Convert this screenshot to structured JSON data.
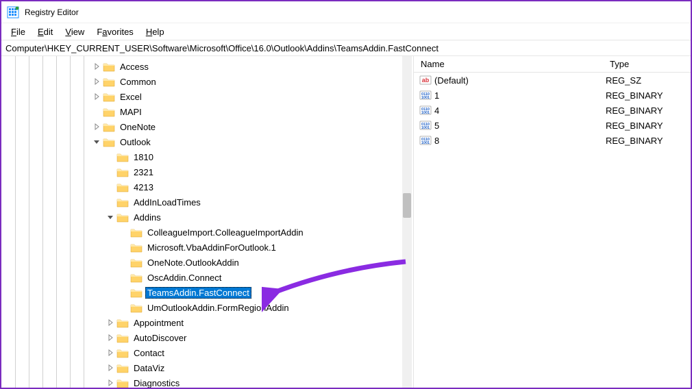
{
  "window": {
    "title": "Registry Editor"
  },
  "menu": {
    "file": "File",
    "edit": "Edit",
    "view": "View",
    "favorites": "Favorites",
    "help": "Help"
  },
  "addressbar": {
    "path": "Computer\\HKEY_CURRENT_USER\\Software\\Microsoft\\Office\\16.0\\Outlook\\Addins\\TeamsAddin.FastConnect"
  },
  "tree": {
    "items": [
      {
        "label": "Access",
        "indent": 7,
        "twisty": "right",
        "selected": false
      },
      {
        "label": "Common",
        "indent": 7,
        "twisty": "right",
        "selected": false
      },
      {
        "label": "Excel",
        "indent": 7,
        "twisty": "right",
        "selected": false
      },
      {
        "label": "MAPI",
        "indent": 7,
        "twisty": "none",
        "selected": false
      },
      {
        "label": "OneNote",
        "indent": 7,
        "twisty": "right",
        "selected": false
      },
      {
        "label": "Outlook",
        "indent": 7,
        "twisty": "down",
        "selected": false
      },
      {
        "label": "1810",
        "indent": 8,
        "twisty": "none",
        "selected": false
      },
      {
        "label": "2321",
        "indent": 8,
        "twisty": "none",
        "selected": false
      },
      {
        "label": "4213",
        "indent": 8,
        "twisty": "none",
        "selected": false
      },
      {
        "label": "AddInLoadTimes",
        "indent": 8,
        "twisty": "none",
        "selected": false
      },
      {
        "label": "Addins",
        "indent": 8,
        "twisty": "down",
        "selected": false
      },
      {
        "label": "ColleagueImport.ColleagueImportAddin",
        "indent": 9,
        "twisty": "none",
        "selected": false
      },
      {
        "label": "Microsoft.VbaAddinForOutlook.1",
        "indent": 9,
        "twisty": "none",
        "selected": false
      },
      {
        "label": "OneNote.OutlookAddin",
        "indent": 9,
        "twisty": "none",
        "selected": false
      },
      {
        "label": "OscAddin.Connect",
        "indent": 9,
        "twisty": "none",
        "selected": false
      },
      {
        "label": "TeamsAddin.FastConnect",
        "indent": 9,
        "twisty": "none",
        "selected": true
      },
      {
        "label": "UmOutlookAddin.FormRegionAddin",
        "indent": 9,
        "twisty": "none",
        "selected": false
      },
      {
        "label": "Appointment",
        "indent": 8,
        "twisty": "right",
        "selected": false
      },
      {
        "label": "AutoDiscover",
        "indent": 8,
        "twisty": "right",
        "selected": false
      },
      {
        "label": "Contact",
        "indent": 8,
        "twisty": "right",
        "selected": false
      },
      {
        "label": "DataViz",
        "indent": 8,
        "twisty": "right",
        "selected": false
      },
      {
        "label": "Diagnostics",
        "indent": 8,
        "twisty": "right",
        "selected": false
      }
    ]
  },
  "values": {
    "col_name": "Name",
    "col_type": "Type",
    "rows": [
      {
        "name": "(Default)",
        "type": "REG_SZ",
        "icon": "string"
      },
      {
        "name": "1",
        "type": "REG_BINARY",
        "icon": "binary"
      },
      {
        "name": "4",
        "type": "REG_BINARY",
        "icon": "binary"
      },
      {
        "name": "5",
        "type": "REG_BINARY",
        "icon": "binary"
      },
      {
        "name": "8",
        "type": "REG_BINARY",
        "icon": "binary"
      }
    ]
  }
}
